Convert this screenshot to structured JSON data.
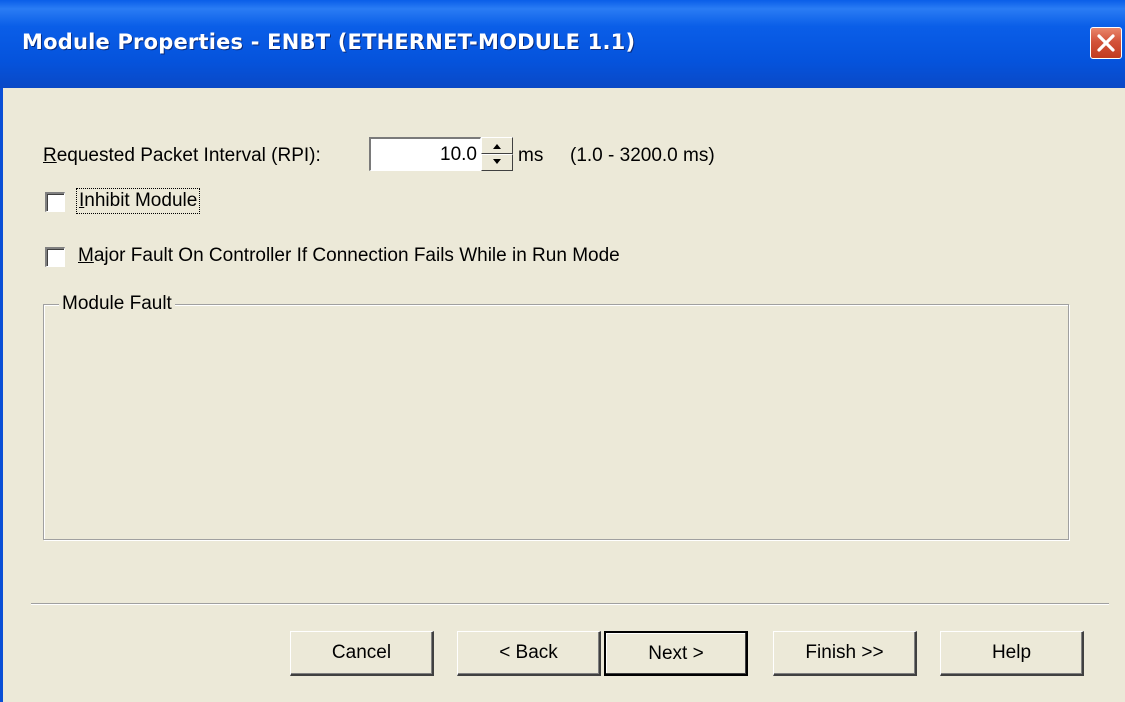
{
  "window": {
    "title": "Module Properties  - ENBT (ETHERNET-MODULE 1.1)",
    "close_icon": "close-icon"
  },
  "rpi": {
    "label_mnemonic": "R",
    "label_rest": "equested Packet Interval (RPI):",
    "value": "10.0",
    "unit": "ms",
    "range": "(1.0 - 3200.0 ms)",
    "spinner_icon": "spinner-arrows-icon"
  },
  "inhibit": {
    "label_mnemonic": "I",
    "label_rest": "nhibit Module",
    "checked": false
  },
  "major_fault": {
    "label_mnemonic": "M",
    "label_rest": "ajor Fault On Controller If Connection Fails While in Run Mode",
    "checked": false
  },
  "module_fault": {
    "legend": "Module Fault",
    "text": ""
  },
  "buttons": {
    "cancel": "Cancel",
    "back": "< Back",
    "next": "Next >",
    "finish": "Finish >>",
    "help": "Help"
  },
  "colors": {
    "titlebar": "#0a5ee8",
    "dialog_background": "#ece9d8",
    "close_button": "#d3533a"
  }
}
